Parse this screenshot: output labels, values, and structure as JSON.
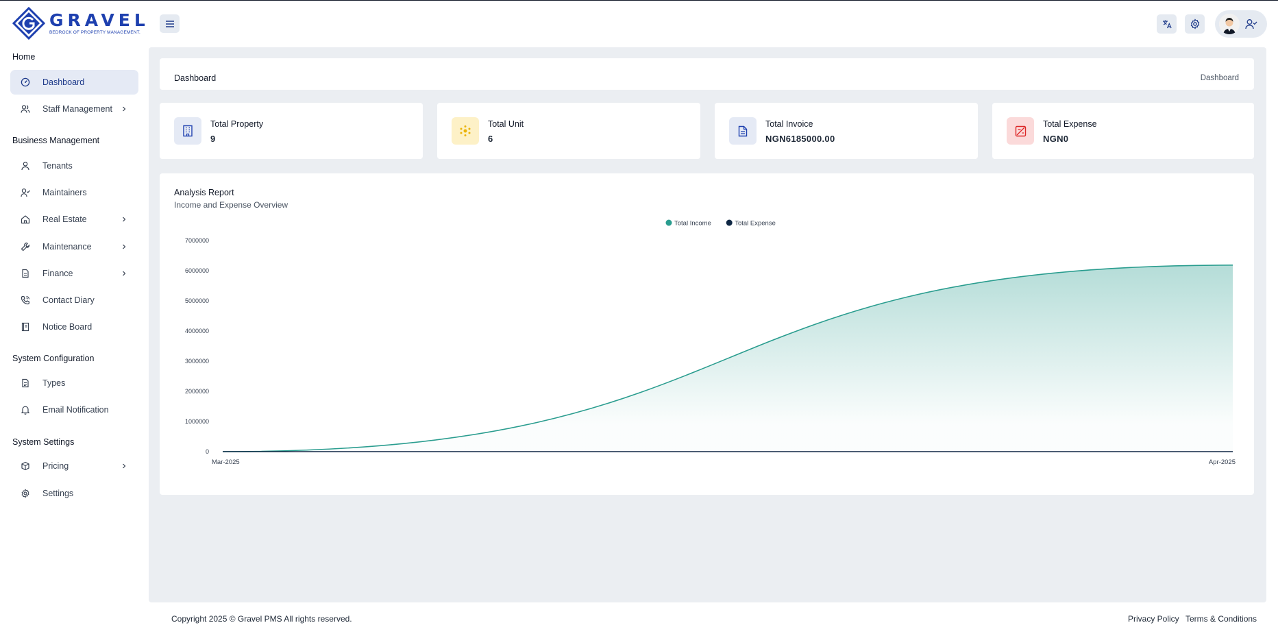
{
  "brand": {
    "name": "GRAVEL",
    "tagline": "BEDROCK OF PROPERTY MANAGEMENT."
  },
  "sidebar": {
    "sections": [
      {
        "title": "Home",
        "items": [
          {
            "label": "Dashboard",
            "icon": "dashboard-icon",
            "active": true,
            "submenu": false
          },
          {
            "label": "Staff Management",
            "icon": "users-icon",
            "active": false,
            "submenu": true
          }
        ]
      },
      {
        "title": "Business Management",
        "items": [
          {
            "label": "Tenants",
            "icon": "user-icon",
            "submenu": false
          },
          {
            "label": "Maintainers",
            "icon": "user-check-icon",
            "submenu": false
          },
          {
            "label": "Real Estate",
            "icon": "home-icon",
            "submenu": true
          },
          {
            "label": "Maintenance",
            "icon": "wrench-icon",
            "submenu": true
          },
          {
            "label": "Finance",
            "icon": "finance-doc-icon",
            "submenu": true
          },
          {
            "label": "Contact Diary",
            "icon": "phone-icon",
            "submenu": false
          },
          {
            "label": "Notice Board",
            "icon": "notice-icon",
            "submenu": false
          }
        ]
      },
      {
        "title": "System Configuration",
        "items": [
          {
            "label": "Types",
            "icon": "file-icon",
            "submenu": false
          },
          {
            "label": "Email Notification",
            "icon": "bell-icon",
            "submenu": false
          }
        ]
      },
      {
        "title": "System Settings",
        "items": [
          {
            "label": "Pricing",
            "icon": "package-icon",
            "submenu": true
          },
          {
            "label": "Settings",
            "icon": "gear-icon",
            "submenu": false
          }
        ]
      }
    ]
  },
  "breadcrumb": {
    "title": "Dashboard",
    "current": "Dashboard"
  },
  "stats": [
    {
      "label": "Total Property",
      "value": "9",
      "icon": "building-icon",
      "bg": "#e5eaf5",
      "color": "#1e40af"
    },
    {
      "label": "Total Unit",
      "value": "6",
      "icon": "unit-icon",
      "bg": "#fdf1c7",
      "color": "#eab308"
    },
    {
      "label": "Total Invoice",
      "value": "NGN6185000.00",
      "icon": "invoice-icon",
      "bg": "#e5eaf5",
      "color": "#1e40af"
    },
    {
      "label": "Total Expense",
      "value": "NGN0",
      "icon": "expense-icon",
      "bg": "#fbdada",
      "color": "#dc2626"
    }
  ],
  "report": {
    "title": "Analysis Report",
    "subtitle": "Income and Expense Overview"
  },
  "chart_data": {
    "type": "area",
    "categories": [
      "Mar-2025",
      "Apr-2025"
    ],
    "series": [
      {
        "name": "Total Income",
        "values": [
          0,
          6185000
        ],
        "color": "#2a9d8f"
      },
      {
        "name": "Total Expense",
        "values": [
          0,
          0
        ],
        "color": "#0f2744"
      }
    ],
    "yticks": [
      "0",
      "1000000",
      "2000000",
      "3000000",
      "4000000",
      "5000000",
      "6000000",
      "7000000"
    ],
    "ylim": [
      0,
      7000000
    ],
    "legend": "top-center",
    "grid": false
  },
  "footer": {
    "copyright": "Copyright 2025 © Gravel PMS All rights reserved.",
    "privacy": "Privacy Policy",
    "terms": "Terms & Conditions"
  }
}
